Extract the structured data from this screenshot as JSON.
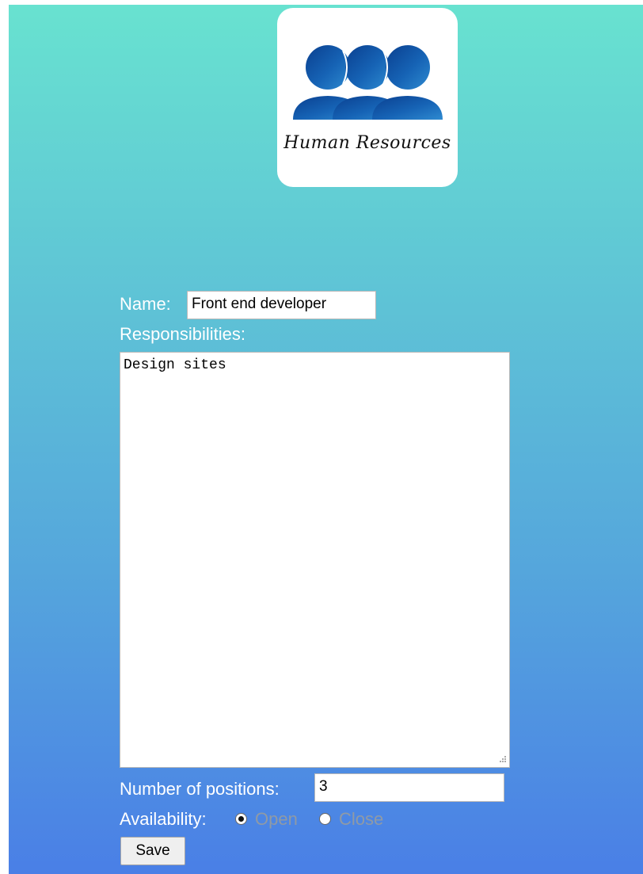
{
  "logo": {
    "text": "Human Resources",
    "icon": "people-group-icon"
  },
  "form": {
    "name_label": "Name:",
    "name_value": "Front end developer",
    "responsibilities_label": "Responsibilities:",
    "responsibilities_value": "Design sites",
    "positions_label": "Number of positions:",
    "positions_value": "3",
    "availability_label": "Availability:",
    "availability_options": [
      {
        "label": "Open",
        "checked": true
      },
      {
        "label": "Close",
        "checked": false
      }
    ],
    "save_label": "Save"
  },
  "colors": {
    "gradient_top": "#68e2d0",
    "gradient_bottom": "#4a7fe6",
    "logo_blue": "#0d4fa0"
  }
}
